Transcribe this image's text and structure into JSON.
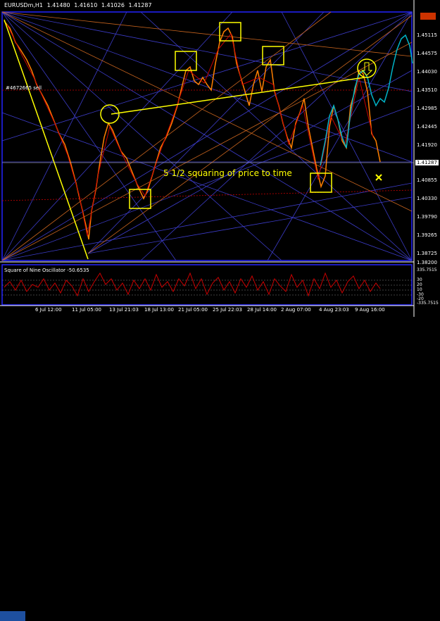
{
  "header": {
    "symbol": "EURUSDm,H1",
    "open": "1.41480",
    "high": "1.41610",
    "low": "1.41026",
    "close": "1.41287"
  },
  "price_axis": [
    "1.45115",
    "1.44575",
    "1.44030",
    "1.43510",
    "1.42985",
    "1.42445",
    "1.41920",
    "1.41287",
    "1.40855",
    "1.40330",
    "1.39790",
    "1.39265",
    "1.38725",
    "1.38200"
  ],
  "current_price": "1.41287",
  "oscillator": {
    "label": "Square of Nine Oscillator -50.6535",
    "scale": [
      "335.7515",
      "30",
      "20",
      "10",
      "-30",
      "-20",
      "-335.7515"
    ]
  },
  "time_axis": [
    "6 Jul 12:00",
    "11 Jul 05:00",
    "13 Jul 21:03",
    "18 Jul 13:00",
    "21 Jul 05:00",
    "25 Jul 22:03",
    "28 Jul 14:00",
    "2 Aug 07:00",
    "4 Aug 23:03",
    "9 Aug 16:00"
  ],
  "annotations": {
    "main": "5 1/2 squaring of price to time",
    "level": "#4672665 sell"
  },
  "colors": {
    "frame": "#2222ff",
    "yellow": "#ffff00",
    "candles_up": "#ff7f00",
    "candles_down": "#c80000",
    "projection": "#00b4c8",
    "fan": "#3c3cc8",
    "fan_orange": "#c8641e"
  }
}
